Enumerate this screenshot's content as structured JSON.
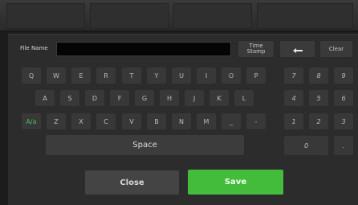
{
  "header": {
    "file_name_label": "File Name",
    "file_name_value": ""
  },
  "toolbar": {
    "time_stamp_label": "Time\nStamp",
    "backspace_icon": "arrow-left-icon",
    "clear_label": "Clear"
  },
  "keyboard": {
    "row1": [
      "Q",
      "W",
      "E",
      "R",
      "T",
      "Y",
      "U",
      "I",
      "O",
      "P"
    ],
    "row2": [
      "A",
      "S",
      "D",
      "F",
      "G",
      "H",
      "J",
      "K",
      "L"
    ],
    "row3": [
      "Z",
      "X",
      "C",
      "V",
      "B",
      "N",
      "M",
      "_",
      "-"
    ],
    "case_toggle": "A/a",
    "space_label": "Space"
  },
  "numpad": {
    "row1": [
      "7",
      "8",
      "9"
    ],
    "row2": [
      "4",
      "5",
      "6"
    ],
    "row3": [
      "1",
      "2",
      "3"
    ],
    "row4": [
      "0",
      "."
    ]
  },
  "actions": {
    "close_label": "Close",
    "save_label": "Save"
  },
  "colors": {
    "accent_green": "#43bb3b"
  }
}
